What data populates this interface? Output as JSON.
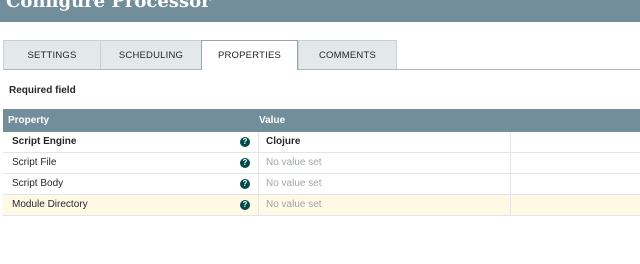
{
  "dialog": {
    "title": "Configure Processor"
  },
  "tabs": [
    {
      "label": "SETTINGS"
    },
    {
      "label": "SCHEDULING"
    },
    {
      "label": "PROPERTIES",
      "active": true
    },
    {
      "label": "COMMENTS"
    }
  ],
  "required_note": "Required field",
  "grid": {
    "headers": {
      "property": "Property",
      "value": "Value"
    },
    "rows": [
      {
        "name": "Script Engine",
        "required": true,
        "value": "Clojure",
        "value_set": true
      },
      {
        "name": "Script File",
        "required": false,
        "value": "No value set",
        "value_set": false
      },
      {
        "name": "Script Body",
        "required": false,
        "value": "No value set",
        "value_set": false
      },
      {
        "name": "Module Directory",
        "required": false,
        "value": "No value set",
        "value_set": false
      }
    ],
    "info_icon_glyph": "?"
  },
  "colors": {
    "header_bg": "#728e9b",
    "info_icon": "#004849",
    "highlight_row": "#fff9e6",
    "placeholder_text": "#a0a6a8"
  }
}
